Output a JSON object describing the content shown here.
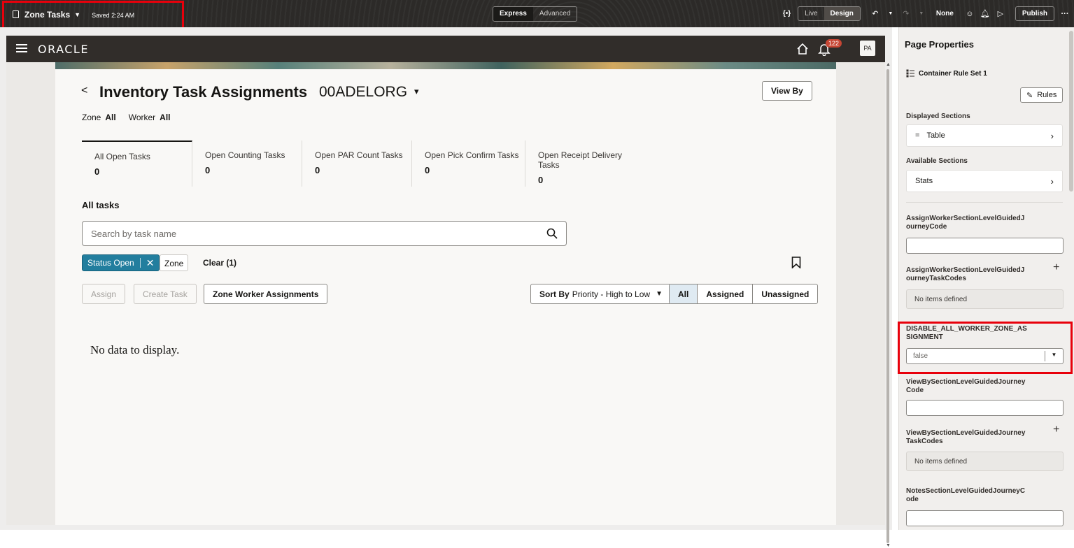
{
  "toolbar": {
    "page_title": "Zone Tasks",
    "saved_status": "Saved 2:24 AM",
    "mode_express": "Express",
    "mode_advanced": "Advanced",
    "braces": "{•}",
    "live_label": "Live",
    "design_label": "Design",
    "none_label": "None",
    "publish_label": "Publish",
    "more_label": "···"
  },
  "app_header": {
    "logo": "ORACLE",
    "notification_count": "122",
    "avatar_initials": "PA"
  },
  "page": {
    "title": "Inventory Task Assignments",
    "org": "00ADELORG",
    "view_by_label": "View By",
    "filters": [
      {
        "label": "Zone",
        "value": "All"
      },
      {
        "label": "Worker",
        "value": "All"
      }
    ],
    "stat_tabs": [
      {
        "label": "All Open Tasks",
        "value": "0"
      },
      {
        "label": "Open Counting Tasks",
        "value": "0"
      },
      {
        "label": "Open PAR Count Tasks",
        "value": "0"
      },
      {
        "label": "Open Pick Confirm Tasks",
        "value": "0"
      },
      {
        "label": "Open Receipt Delivery Tasks",
        "value": "0"
      }
    ],
    "section_title": "All tasks",
    "search_placeholder": "Search by task name",
    "chip_status": "Status Open",
    "chip_zone": "Zone",
    "clear_label": "Clear (1)",
    "assign_label": "Assign",
    "create_task_label": "Create Task",
    "zone_worker_label": "Zone Worker Assignments",
    "sort_prefix": "Sort By",
    "sort_value": "Priority - High to Low",
    "seg_all": "All",
    "seg_assigned": "Assigned",
    "seg_unassigned": "Unassigned",
    "empty_message": "No data to display."
  },
  "panel": {
    "title": "Page Properties",
    "rule_set": "Container Rule Set 1",
    "rules_button": "Rules",
    "displayed_sections_label": "Displayed Sections",
    "displayed_section_item": "Table",
    "available_sections_label": "Available Sections",
    "available_section_item": "Stats",
    "prop1_label": "AssignWorkerSectionLevelGuidedJourneyCode",
    "prop2_label": "AssignWorkerSectionLevelGuidedJourneyTaskCodes",
    "prop2_empty": "No items defined",
    "prop3_label": "DISABLE_ALL_WORKER_ZONE_ASSIGNMENT",
    "prop3_value": "false",
    "prop4_label": "ViewBySectionLevelGuidedJourneyCode",
    "prop5_label": "ViewBySectionLevelGuidedJourneyTaskCodes",
    "prop5_empty": "No items defined",
    "prop6_label": "NotesSectionLevelGuidedJourneyCode"
  }
}
